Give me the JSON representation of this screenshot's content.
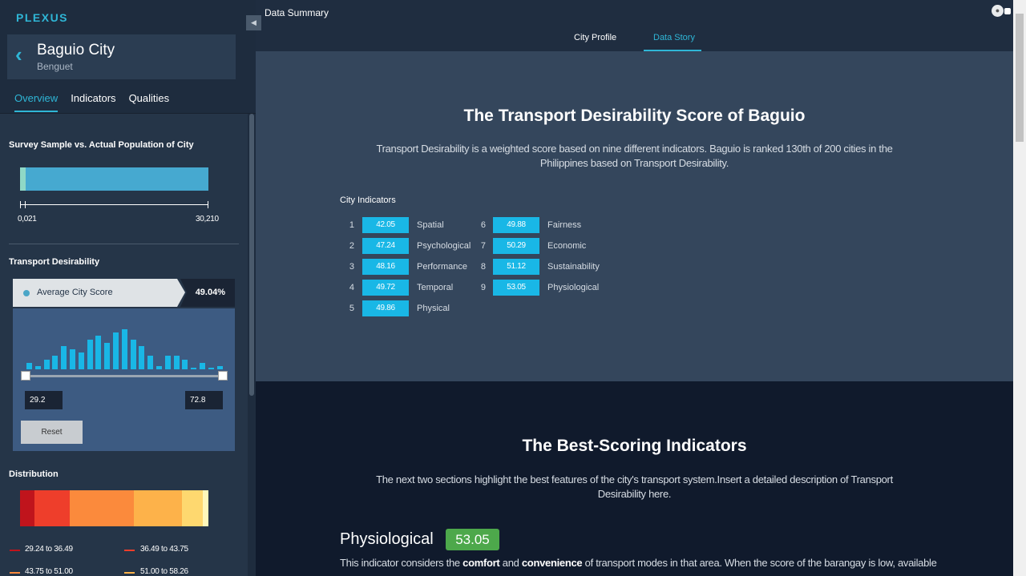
{
  "brand": "PLEXUS",
  "city": {
    "name": "Baguio City",
    "province": "Benguet"
  },
  "side_tabs": [
    "Overview",
    "Indicators",
    "Qualities"
  ],
  "survey": {
    "title": "Survey Sample vs. Actual Population of City",
    "sample_label": "0,021",
    "population_label": "30,210",
    "sample_fraction": 0.03
  },
  "transport": {
    "title": "Transport Desirability",
    "score_label": "Average City Score",
    "score_value": "49.04%",
    "histogram": [
      2,
      1,
      3,
      4,
      7,
      6,
      5,
      9,
      10,
      8,
      11,
      12,
      9,
      7,
      4,
      1,
      4,
      4,
      3,
      0,
      2,
      0,
      1
    ],
    "min_value": "29.2",
    "max_value": "72.8",
    "reset_label": "Reset"
  },
  "distribution": {
    "title": "Distribution",
    "colors": [
      "#c0141c",
      "#ee3e2b",
      "#fb8a3c",
      "#fdb24a",
      "#fed86f",
      "#fef7ba"
    ],
    "legend": [
      {
        "label": "29.24 to 36.49",
        "color": "#c0141c"
      },
      {
        "label": "36.49 to 43.75",
        "color": "#ee3e2b"
      },
      {
        "label": "43.75 to 51.00",
        "color": "#fb8a3c"
      },
      {
        "label": "51.00 to 58.26",
        "color": "#fdb24a"
      }
    ]
  },
  "topbar": {
    "title": "Data Summary",
    "tabs": [
      "City Profile",
      "Data Story"
    ],
    "active_tab": "Data Story"
  },
  "section1": {
    "heading": "The Transport Desirability Score of Baguio",
    "description_line1": "Transport Desirability is a weighted score based on nine different indicators. Baguio is ranked 130th of 200 cities in the",
    "description_line2": "Philippines based on Transport Desirability.",
    "indicators_title": "City Indicators",
    "indicators": [
      {
        "num": "1",
        "value": "42.05",
        "name": "Spatial"
      },
      {
        "num": "2",
        "value": "47.24",
        "name": "Psychological"
      },
      {
        "num": "3",
        "value": "48.16",
        "name": "Performance"
      },
      {
        "num": "4",
        "value": "49.72",
        "name": "Temporal"
      },
      {
        "num": "5",
        "value": "49.86",
        "name": "Physical"
      },
      {
        "num": "6",
        "value": "49.88",
        "name": "Fairness"
      },
      {
        "num": "7",
        "value": "50.29",
        "name": "Economic"
      },
      {
        "num": "8",
        "value": "51.12",
        "name": "Sustainability"
      },
      {
        "num": "9",
        "value": "53.05",
        "name": "Physiological"
      }
    ]
  },
  "section2": {
    "heading": "The Best-Scoring Indicators",
    "description_line1": "The next two sections highlight the best features of the city's transport system.Insert a detailed description of Transport",
    "description_line2": "Desirability here.",
    "best": {
      "title": "Physiological",
      "score": "53.05",
      "text_a": "This indicator considers the ",
      "bold1": "comfort",
      "text_b": " and ",
      "bold2": "convenience",
      "text_c": " of transport modes in that area. When the score of the barangay is low, available transport modes in that area may be uncomfortable and inconvenient. Transport modes may be far from residents and"
    }
  }
}
